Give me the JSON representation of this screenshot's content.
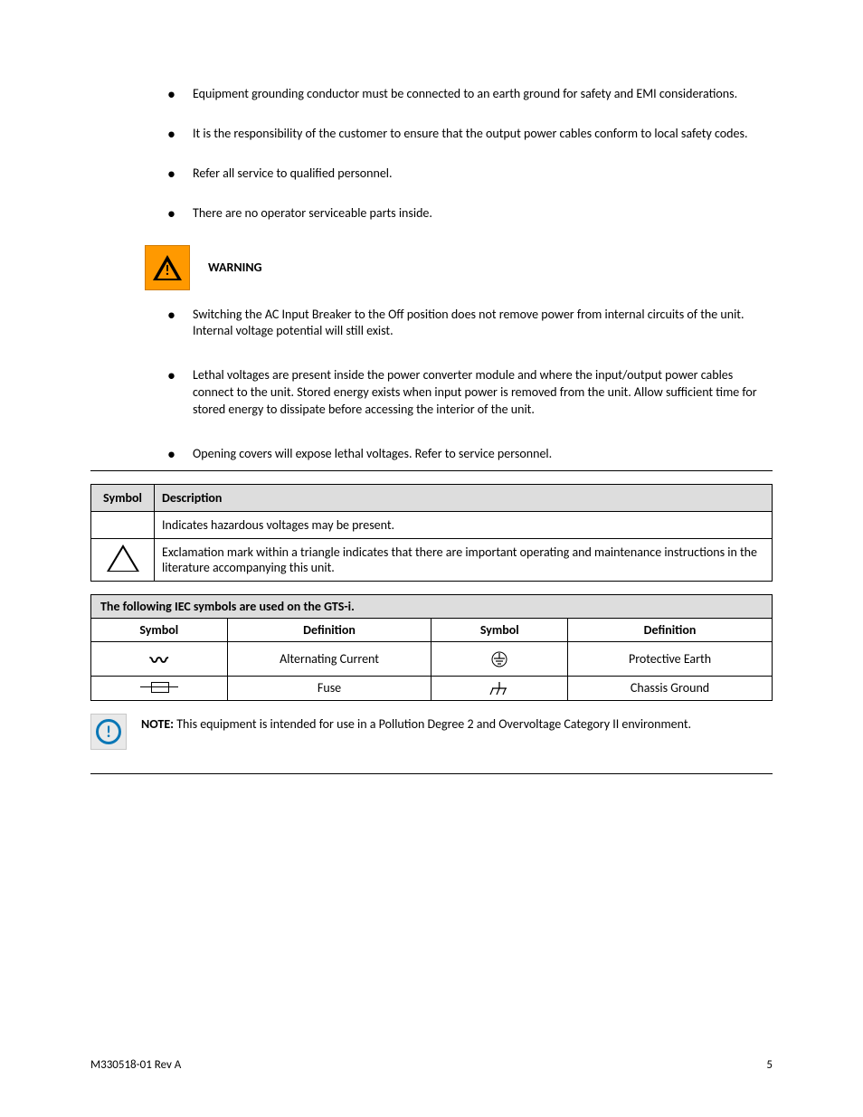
{
  "section1": {
    "bullets": [
      "Equipment grounding conductor must be connected to an earth ground for safety and EMI considerations.",
      "It is the responsibility of the customer to ensure that the output power cables conform to local safety codes.",
      "Refer all service to qualified personnel.",
      "There are no operator serviceable parts inside."
    ]
  },
  "warning_label": "WARNING",
  "section2": {
    "bullets": [
      "Switching the AC Input Breaker to the Off position does not remove power from internal circuits of the unit. Internal voltage potential will still exist.",
      "Lethal voltages are present inside the power converter module and where the input/output power cables connect to the unit. Stored energy exists when input power is removed from the unit. Allow sufficient time for stored energy to dissipate before accessing the interior of the unit.",
      "Opening covers will expose lethal voltages. Refer to service personnel."
    ]
  },
  "hazexp_table": {
    "headers": [
      "Symbol",
      "Description"
    ],
    "rows": [
      {
        "symbol": "",
        "desc": "Indicates hazardous voltages may be present."
      },
      {
        "symbol": "triangle",
        "desc": "Exclamation mark within a triangle indicates that there are important operating and maintenance instructions in the literature accompanying this unit."
      }
    ]
  },
  "symbols_table": {
    "title": "The following IEC symbols are used on the GTS-i.",
    "columns": [
      "Symbol",
      "Definition",
      "Symbol",
      "Definition"
    ],
    "rows": [
      [
        "ac",
        "Alternating Current",
        "pe",
        "Protective Earth"
      ],
      [
        "fuse",
        "Fuse",
        "cg",
        "Chassis Ground"
      ]
    ]
  },
  "note": {
    "label": "NOTE:",
    "text": "This equipment is intended for use in a Pollution Degree 2 and Overvoltage Category II environment."
  },
  "footer": {
    "left": "M330518-01 Rev A",
    "right": "5"
  }
}
